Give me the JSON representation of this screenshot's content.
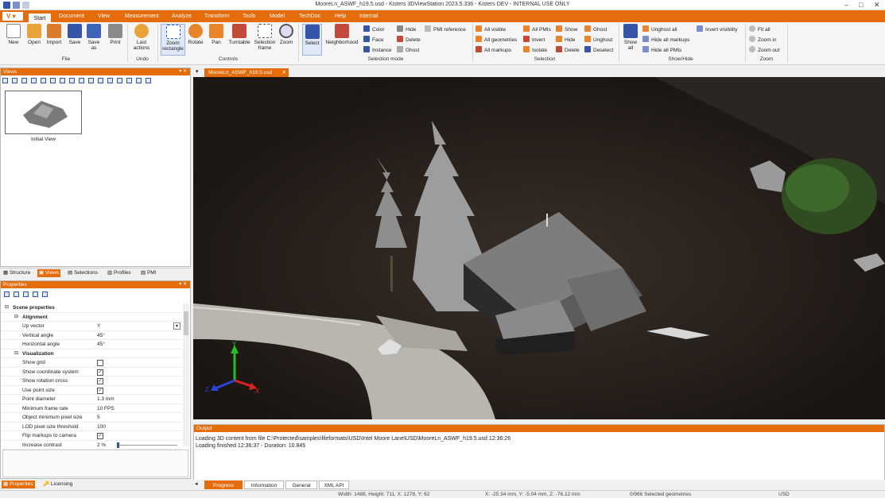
{
  "window": {
    "title": "MooreLn_ASWF_h19.5.usd - Kisters 3DViewStation 2023.5.336 - Kisters DEV - INTERNAL USE ONLY"
  },
  "app_button": "V",
  "menu": [
    "Start",
    "Document",
    "View",
    "Measurement",
    "Analyze",
    "Transform",
    "Tools",
    "Model",
    "TechDoc",
    "Help",
    "Internal"
  ],
  "ribbon": {
    "file": {
      "new": "New",
      "open": "Open",
      "import": "Import",
      "save": "Save",
      "save_as": "Save as",
      "print": "Print",
      "group": "File"
    },
    "undo": {
      "last_actions": "Last actions",
      "group": "Undo"
    },
    "controls": {
      "zoom_rect": "Zoom rectangle",
      "rotate": "Rotate",
      "pan": "Pan",
      "turntable": "Turntable",
      "selection_frame": "Selection frame",
      "zoom": "Zoom",
      "group": "Controls"
    },
    "selmode": {
      "select": "Select",
      "neighborhood": "Neighborhood",
      "color": "Color",
      "face": "Face",
      "instance": "Instance",
      "hide": "Hide",
      "delete": "Delete",
      "ghost": "Ghost",
      "pmi_reference": "PMI reference",
      "group": "Selection mode"
    },
    "selection": {
      "all_visible": "All visible",
      "all_geometries": "All geometries",
      "all_markups": "All markups",
      "all_pmis": "All PMIs",
      "invert": "Invert",
      "isolate": "Isolate",
      "show": "Show",
      "hide": "Hide",
      "delete": "Delete",
      "ghost": "Ghost",
      "unghost": "Unghost",
      "deselect": "Deselect",
      "group": "Selection"
    },
    "showhide": {
      "show_all": "Show all",
      "unghost_all": "Unghost all",
      "hide_all_markups": "Hide all markups",
      "hide_all_pmis": "Hide all PMIs",
      "invert_visibility": "Invert visibility",
      "group": "Show/Hide"
    },
    "zoom": {
      "fit_all": "Fit all",
      "zoom_in": "Zoom in",
      "zoom_out": "Zoom out",
      "group": "Zoom"
    }
  },
  "views_panel": {
    "title": "Views",
    "thumb_label": "Initial View"
  },
  "panel_tabs": [
    "Structure",
    "Views",
    "Selections",
    "Profiles",
    "PMI"
  ],
  "properties": {
    "title": "Properties",
    "scene": "Scene properties",
    "alignment": "Alignment",
    "rows_align": [
      {
        "k": "Up vector",
        "v": "Y"
      },
      {
        "k": "Vertical angle",
        "v": "45°"
      },
      {
        "k": "Horizontal angle",
        "v": "45°"
      }
    ],
    "visualization": "Visualization",
    "rows_vis": [
      {
        "k": "Show grid",
        "v": ""
      },
      {
        "k": "Show coordinate system",
        "v": "✓"
      },
      {
        "k": "Show rotation cross",
        "v": "✓"
      },
      {
        "k": "Use point size",
        "v": "✓"
      },
      {
        "k": "Point diameter",
        "v": "1.3 mm"
      },
      {
        "k": "Minimum frame rate",
        "v": "10 FPS"
      },
      {
        "k": "Object minimum pixel size",
        "v": "5"
      },
      {
        "k": "LOD pixel size threshold",
        "v": "100"
      },
      {
        "k": "Flip markups to camera",
        "v": "✓"
      },
      {
        "k": "Increase contrast",
        "v": "2 %"
      }
    ]
  },
  "bottom_tabs": [
    "Properties",
    "Licensing"
  ],
  "document_tab": "MooreLn_ASWF_h19.5.usd",
  "output": {
    "title": "Output",
    "lines": [
      "Loading 3D content from file C:\\Protected\\samples\\fileformats\\USD\\Intel Moore Lane\\USD\\MooreLn_ASWF_h19.5.usd 12:36:26",
      "Loading finished 12:36:37 - Duration: 10.845"
    ],
    "tabs": [
      "Progress",
      "Information",
      "General",
      "XML API"
    ]
  },
  "status": {
    "dims": "Width: 1488, Height: 711, X: 1278, Y: 62",
    "coords": "X: -25.34 mm, Y: -5.04 mm, Z: -76.12 mm",
    "sel": "0/966 Selected geometries",
    "fmt": "USD"
  },
  "axes": {
    "x": "X",
    "y": "Y",
    "z": "Z"
  },
  "colors": {
    "accent": "#e46c0a"
  }
}
